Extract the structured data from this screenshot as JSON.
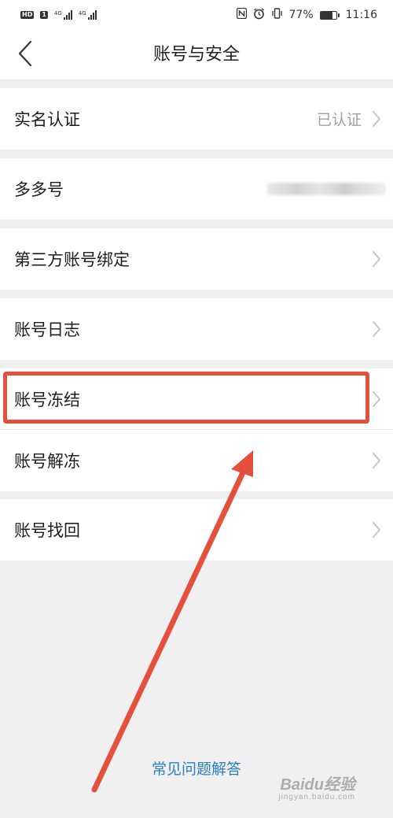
{
  "status_bar": {
    "hd_label": "HD",
    "sim1_label": "1",
    "signal1_type": "4G",
    "signal2_type": "4G",
    "battery_percent": "77%",
    "battery_level": 0.77,
    "time": "11:16",
    "icons": [
      "nfc-icon",
      "alarm-icon",
      "vibrate-icon"
    ]
  },
  "nav": {
    "back_icon": "chevron-left-icon",
    "title": "账号与安全"
  },
  "menu": {
    "items": [
      {
        "label": "实名认证",
        "value": "已认证"
      },
      {
        "label": "多多号",
        "value": ""
      },
      {
        "label": "第三方账号绑定",
        "value": ""
      },
      {
        "label": "账号日志",
        "value": ""
      },
      {
        "label": "账号冻结",
        "value": ""
      },
      {
        "label": "账号解冻",
        "value": ""
      },
      {
        "label": "账号找回",
        "value": ""
      }
    ]
  },
  "footer": {
    "faq_label": "常见问题解答"
  },
  "watermark": {
    "main": "Baidu经验",
    "sub": "jingyan.baidu.com"
  },
  "colors": {
    "highlight": "#e4503c",
    "link": "#2b7fc4",
    "background": "#f0f0f0"
  }
}
